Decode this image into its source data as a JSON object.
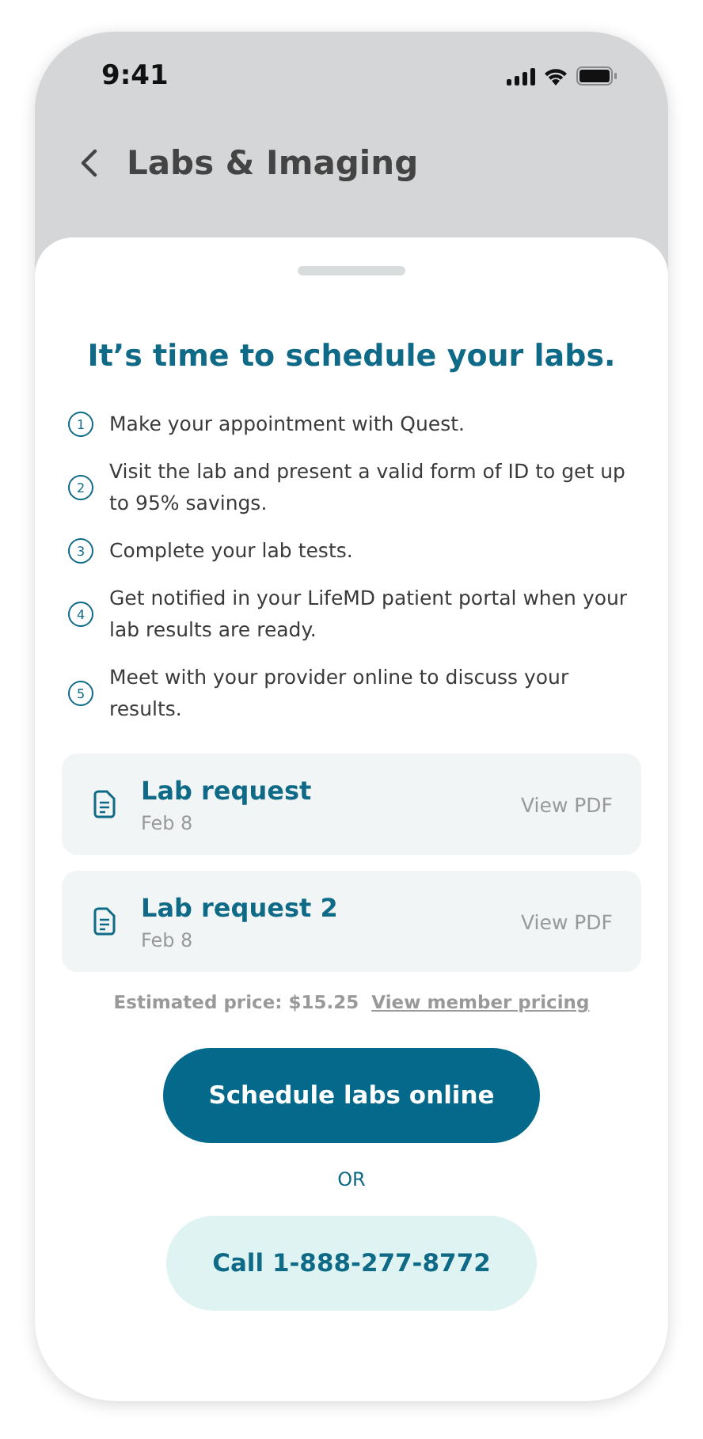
{
  "status_bar": {
    "time": "9:41"
  },
  "nav": {
    "title": "Labs & Imaging"
  },
  "sheet": {
    "title": "It’s time to schedule your labs.",
    "steps": [
      {
        "number": "1",
        "text": "Make your appointment with Quest."
      },
      {
        "number": "2",
        "text": "Visit the lab and present a valid form of ID to get up to 95% savings."
      },
      {
        "number": "3",
        "text": "Complete your lab tests."
      },
      {
        "number": "4",
        "text": "Get notified in your LifeMD patient portal when your lab results are ready."
      },
      {
        "number": "5",
        "text": "Meet with your provider online to discuss your results."
      }
    ],
    "documents": [
      {
        "title": "Lab request",
        "date": "Feb 8",
        "action": "View PDF"
      },
      {
        "title": "Lab request 2",
        "date": "Feb 8",
        "action": "View PDF"
      }
    ],
    "price": {
      "text": "Estimated price: $15.25",
      "link": "View member pricing"
    },
    "primary_button": "Schedule labs online",
    "separator": "OR",
    "secondary_button": "Call 1-888-277-8772"
  }
}
